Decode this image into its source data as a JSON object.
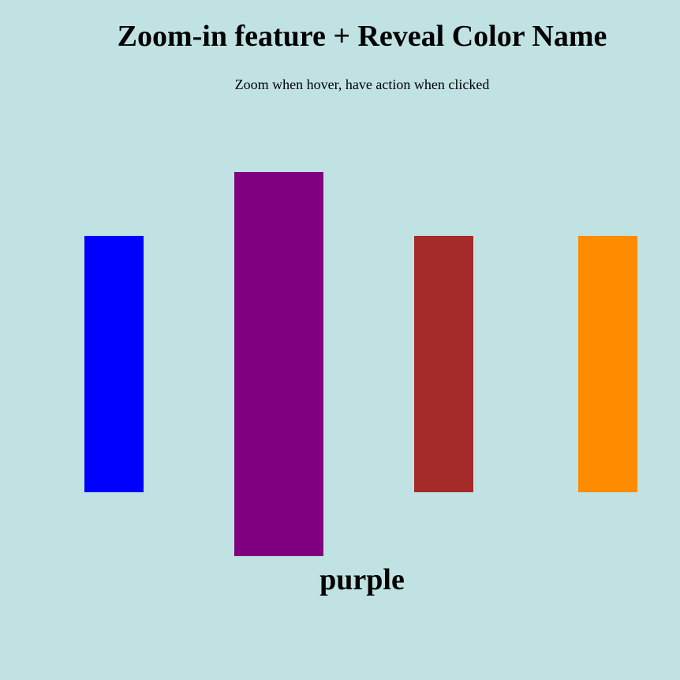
{
  "page": {
    "title": "Zoom-in feature + Reveal Color Name",
    "subtitle": "Zoom when hover, have action when clicked",
    "background_color": "#c1e2e3"
  },
  "swatches": [
    {
      "name": "blue",
      "color": "#0000ff",
      "zoomed": false
    },
    {
      "name": "purple",
      "color": "#800080",
      "zoomed": true
    },
    {
      "name": "brown",
      "color": "#a52a2a",
      "zoomed": false
    },
    {
      "name": "orange",
      "color": "#ff8c00",
      "zoomed": false
    }
  ],
  "revealed_color_name": "purple"
}
